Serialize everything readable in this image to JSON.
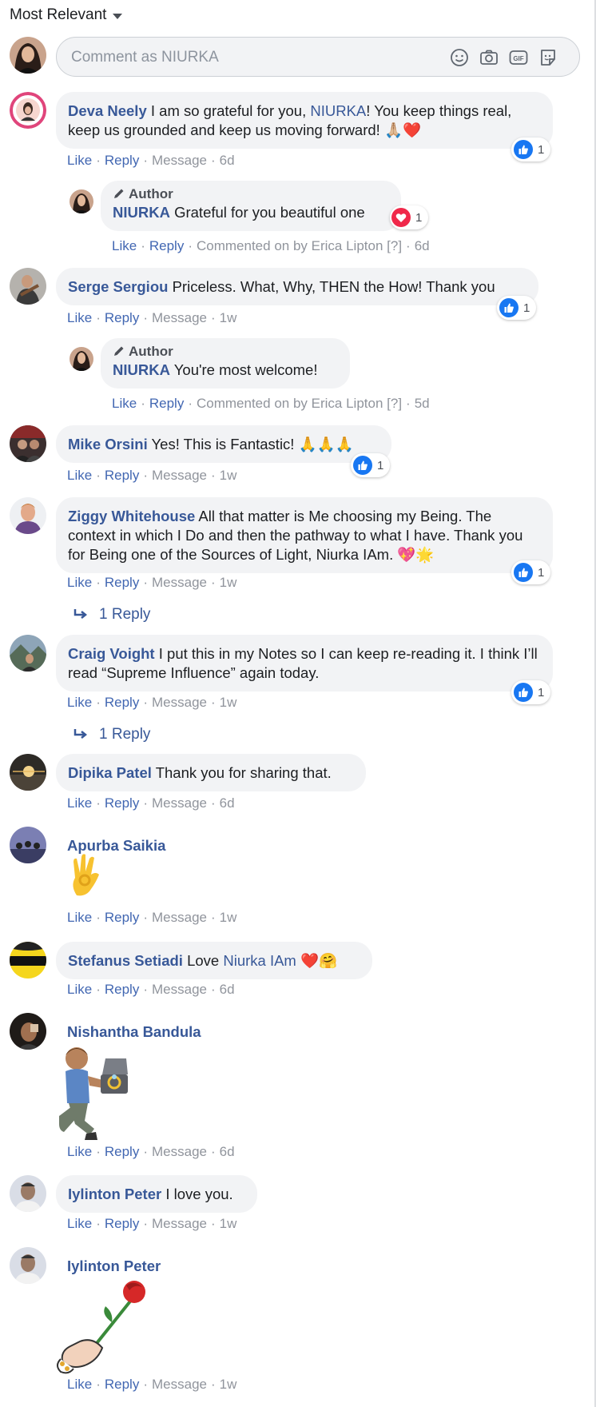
{
  "sort": {
    "label": "Most Relevant"
  },
  "composer": {
    "placeholder": "Comment as NIURKA"
  },
  "actions": {
    "like": "Like",
    "reply": "Reply",
    "message": "Message",
    "dot": "·"
  },
  "comments": [
    {
      "name": "Deva Neely",
      "text_a": " I am so grateful for you, ",
      "mention": "NIURKA",
      "text_b": "! You keep things real, keep us grounded and keep us moving forward! ",
      "emoji": "🙏🏼❤️",
      "likes": "1",
      "time": "6d"
    },
    {
      "name": "Serge Sergiou",
      "text": " Priceless. What, Why, THEN the How! Thank you",
      "likes": "1",
      "time": "1w"
    },
    {
      "name": "Mike Orsini",
      "text": " Yes! This is Fantastic! ",
      "emoji": "🙏🙏🙏",
      "likes": "1",
      "time": "1w"
    },
    {
      "name": "Ziggy Whitehouse",
      "text": " All that matter is Me choosing my Being. The context in which I Do and then the pathway to what I have. Thank you for Being one of the Sources of Light, Niurka IAm. ",
      "emoji": "💖🌟",
      "likes": "1",
      "time": "1w",
      "replies": "1 Reply"
    },
    {
      "name": "Craig Voight",
      "text": " I put this in my Notes so I can keep re-reading it. I think I’ll read “Supreme Influence” again today.",
      "likes": "1",
      "time": "1w",
      "replies": "1 Reply"
    },
    {
      "name": "Dipika Patel",
      "text": " Thank you for sharing that.",
      "time": "6d"
    },
    {
      "name": "Apurba Saikia",
      "time": "1w"
    },
    {
      "name": "Stefanus Setiadi",
      "text": " Love ",
      "mention": "Niurka IAm",
      "emoji": "❤️🤗",
      "time": "6d"
    },
    {
      "name": "Nishantha Bandula",
      "time": "6d"
    },
    {
      "name": "Iylinton Peter",
      "text": " I love you.",
      "time": "1w"
    },
    {
      "name": "Iylinton Peter",
      "time": "1w"
    }
  ],
  "author_replies": [
    {
      "badge": "Author",
      "name": "NIURKA",
      "text": " Grateful for you beautiful one",
      "likes": "1",
      "commented": "Commented on by Erica Lipton",
      "help": "[?]",
      "time": "6d"
    },
    {
      "badge": "Author",
      "name": "NIURKA",
      "text": " You're most welcome!",
      "commented": "Commented on by Erica Lipton",
      "help": "[?]",
      "time": "5d"
    }
  ],
  "colors": {
    "link": "#385898",
    "action": "#4267b2",
    "meta": "#90949c",
    "bubble": "#f2f3f5",
    "like_blue": "#1877f2",
    "love_red": "#f0284a"
  },
  "icons": [
    "chevron-down-icon",
    "smiley-icon",
    "camera-icon",
    "gif-icon",
    "sticker-icon",
    "like-reaction-icon",
    "love-reaction-icon",
    "pencil-icon",
    "reply-arrow-icon"
  ]
}
